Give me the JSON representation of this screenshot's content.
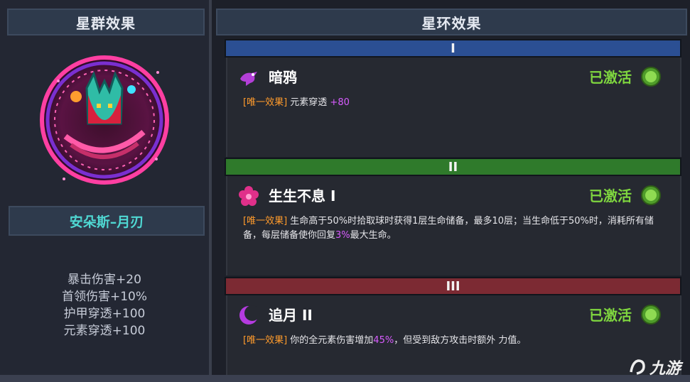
{
  "left": {
    "header": "星群效果",
    "constellation_name": "安朵斯–月刃",
    "stats": [
      "暴击伤害+20",
      "首领伤害+10%",
      "护甲穿透+100",
      "元素穿透+100"
    ]
  },
  "right": {
    "header": "星环效果",
    "tiers": [
      {
        "numeral": "I",
        "bar_color": "#2b4f93",
        "icon": "crow-icon",
        "title": "暗鸦",
        "status": "已激活",
        "tag": "[唯一效果]",
        "desc_pre": " 元素穿透 ",
        "desc_hl": "+80",
        "desc_post": ""
      },
      {
        "numeral": "II",
        "bar_color": "#2f7a2b",
        "icon": "flower-icon",
        "title": "生生不息 I",
        "status": "已激活",
        "tag": "[唯一效果]",
        "desc_pre": " 生命高于50%时拾取球时获得1层生命储备，最多10层；当生命低于50%时，消耗所有储备，每层储备使你回复",
        "desc_hl": "3%",
        "desc_post": "最大生命。"
      },
      {
        "numeral": "III",
        "bar_color": "#7c2a33",
        "icon": "crescent-moon-icon",
        "title": "追月 II",
        "status": "已激活",
        "tag": "[唯一效果]",
        "desc_pre": " 你的全元素伤害增加",
        "desc_hl": "45%",
        "desc_post": "，但受到敌方攻击时额外 力值。"
      }
    ]
  },
  "watermark": "九游"
}
